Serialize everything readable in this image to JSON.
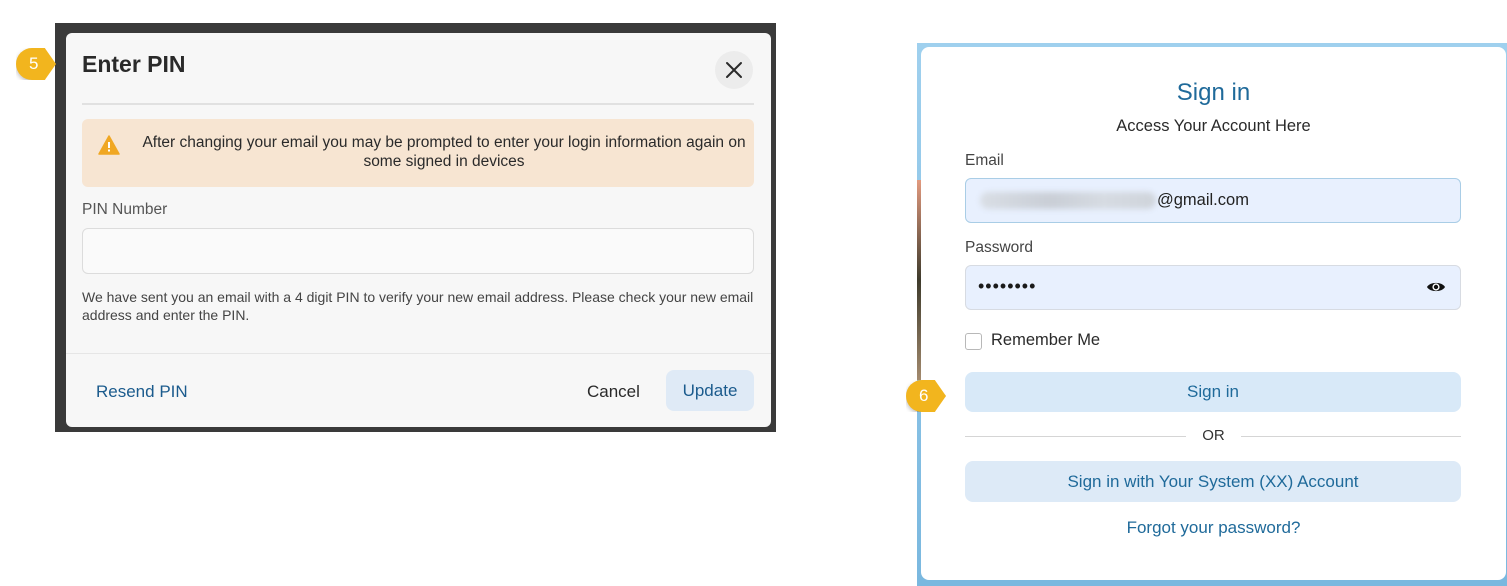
{
  "step_badges": {
    "first": "5",
    "second": "6"
  },
  "pin_dialog": {
    "title": "Enter PIN",
    "close_icon": "close-icon",
    "warning": {
      "icon": "warning-triangle-icon",
      "text": "After changing your email you may be prompted to enter your login information again on some signed in devices"
    },
    "pin_label": "PIN Number",
    "pin_value": "",
    "help_text": "We have sent you an email with a 4 digit PIN to verify your new email address. Please check your new email address and enter the PIN.",
    "resend_label": "Resend PIN",
    "cancel_label": "Cancel",
    "update_label": "Update"
  },
  "signin": {
    "title": "Sign in",
    "subtitle": "Access Your Account Here",
    "email_label": "Email",
    "email_domain": "@gmail.com",
    "password_label": "Password",
    "password_masked": "••••••••",
    "password_toggle_icon": "eye-icon",
    "remember_label": "Remember Me",
    "remember_checked": false,
    "signin_button": "Sign in",
    "or_text": "OR",
    "sso_button": "Sign in with Your System (XX) Account",
    "forgot_link": "Forgot your password?"
  },
  "colors": {
    "badge": "#f2b51e",
    "link_blue": "#1b5b8d",
    "warning_bg": "#f7e5d2",
    "warning_icon": "#f0a723",
    "button_bg": "#d8e9f8",
    "input_bg": "#e8f0fe"
  }
}
